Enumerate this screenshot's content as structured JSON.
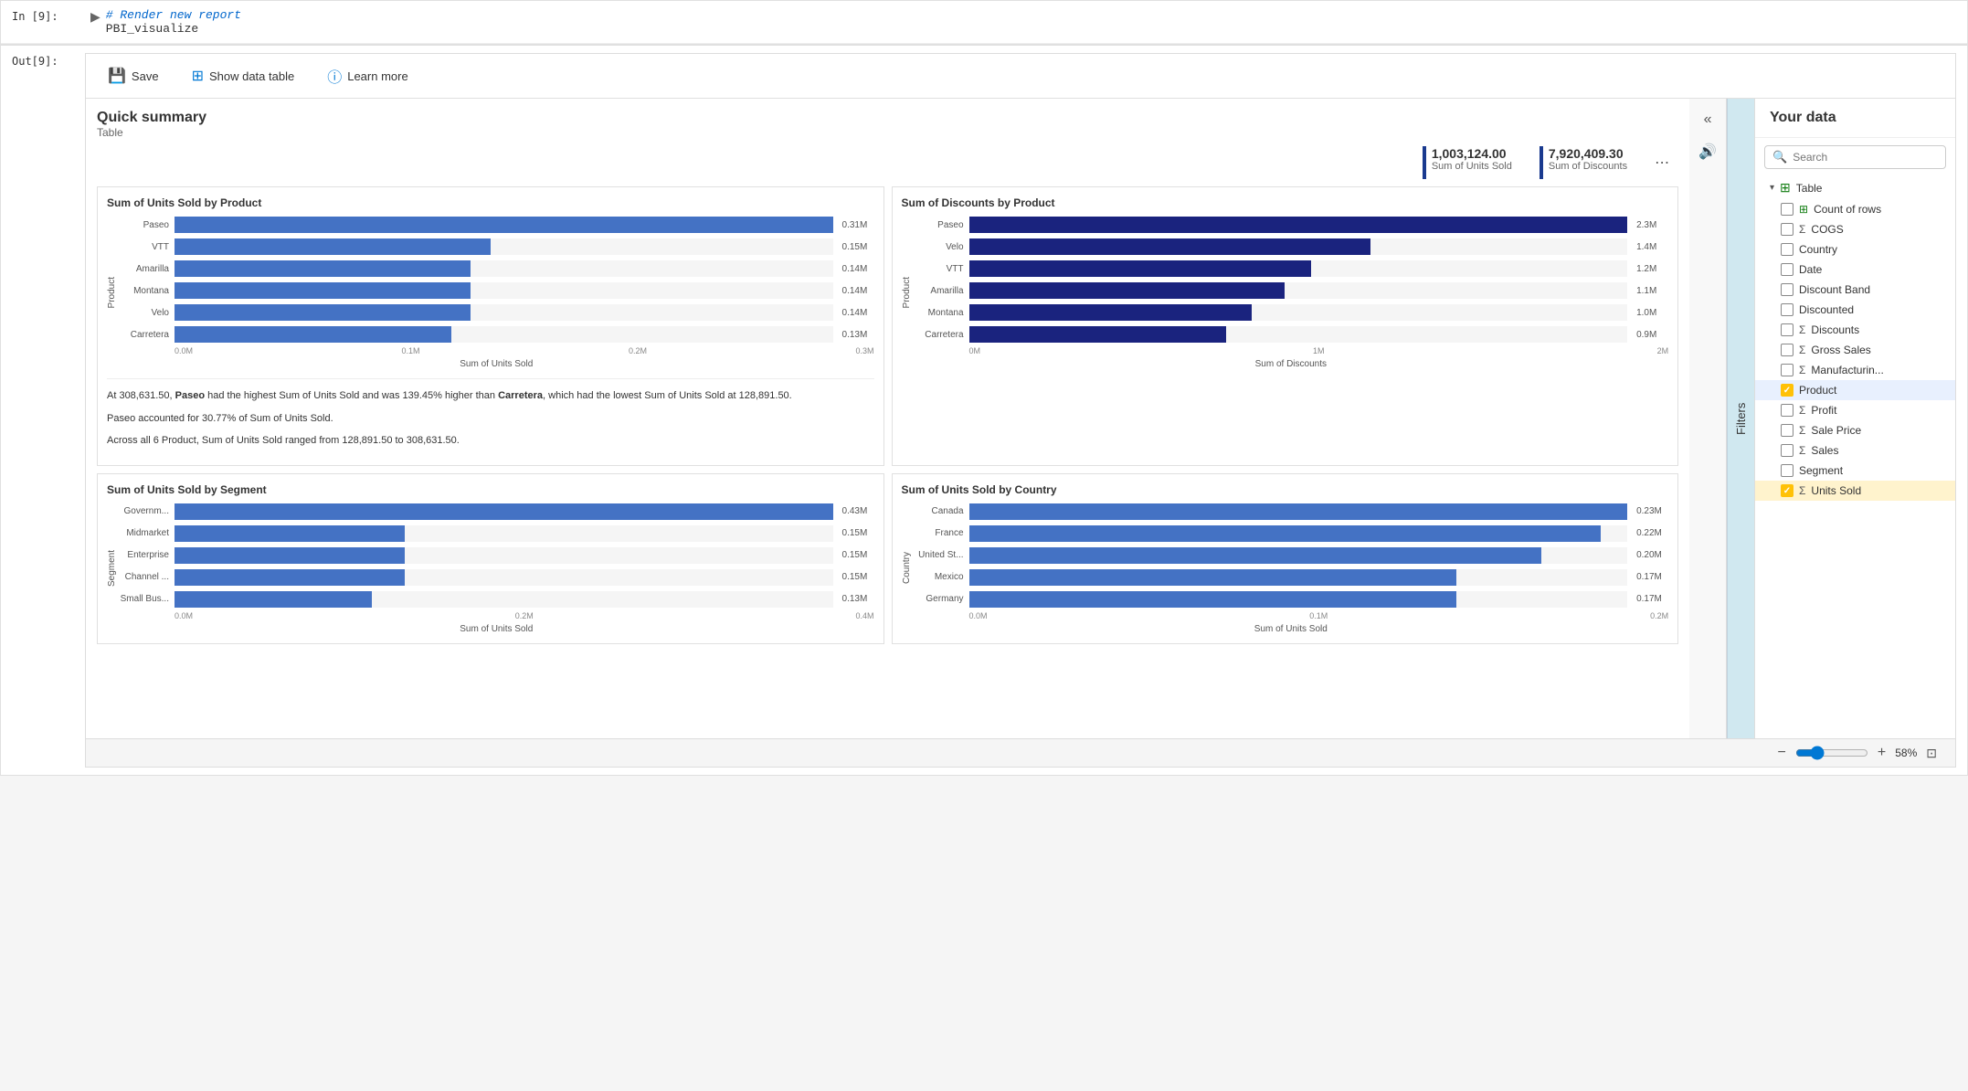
{
  "cell_input": {
    "label": "In [9]:",
    "code_comment": "# Render new report",
    "code_func": "PBI_visualize"
  },
  "cell_output": {
    "label": "Out[9]:"
  },
  "toolbar": {
    "save_label": "Save",
    "show_data_table_label": "Show data table",
    "learn_more_label": "Learn more"
  },
  "quick_summary": {
    "title": "Quick summary",
    "subtitle": "Table"
  },
  "stats": [
    {
      "value": "1,003,124.00",
      "label": "Sum of Units Sold"
    },
    {
      "value": "7,920,409.30",
      "label": "Sum of Discounts"
    }
  ],
  "chart1": {
    "title": "Sum of Units Sold by Product",
    "y_axis_label": "Product",
    "x_axis_label": "Sum of Units Sold",
    "x_ticks": [
      "0.0M",
      "0.1M",
      "0.2M",
      "0.3M"
    ],
    "bars": [
      {
        "label": "Paseo",
        "value": "0.31M",
        "pct": 100
      },
      {
        "label": "VTT",
        "value": "0.15M",
        "pct": 48
      },
      {
        "label": "Amarilla",
        "value": "0.14M",
        "pct": 45
      },
      {
        "label": "Montana",
        "value": "0.14M",
        "pct": 45
      },
      {
        "label": "Velo",
        "value": "0.14M",
        "pct": 45
      },
      {
        "label": "Carretera",
        "value": "0.13M",
        "pct": 42
      }
    ]
  },
  "chart2": {
    "title": "Sum of Discounts by Product",
    "y_axis_label": "Product",
    "x_axis_label": "Sum of Discounts",
    "x_ticks": [
      "0M",
      "1M",
      "2M"
    ],
    "bars": [
      {
        "label": "Paseo",
        "value": "2.3M",
        "pct": 100
      },
      {
        "label": "Velo",
        "value": "1.4M",
        "pct": 61
      },
      {
        "label": "VTT",
        "value": "1.2M",
        "pct": 52
      },
      {
        "label": "Amarilla",
        "value": "1.1M",
        "pct": 48
      },
      {
        "label": "Montana",
        "value": "1.0M",
        "pct": 43
      },
      {
        "label": "Carretera",
        "value": "0.9M",
        "pct": 39
      }
    ]
  },
  "chart3": {
    "title": "Sum of Units Sold by Segment",
    "y_axis_label": "Segment",
    "x_axis_label": "Sum of Units Sold",
    "x_ticks": [
      "0.0M",
      "0.2M",
      "0.4M"
    ],
    "bars": [
      {
        "label": "Governm...",
        "value": "0.43M",
        "pct": 100
      },
      {
        "label": "Midmarket",
        "value": "0.15M",
        "pct": 35
      },
      {
        "label": "Enterprise",
        "value": "0.15M",
        "pct": 35
      },
      {
        "label": "Channel ...",
        "value": "0.15M",
        "pct": 35
      },
      {
        "label": "Small Bus...",
        "value": "0.13M",
        "pct": 30
      }
    ]
  },
  "chart4": {
    "title": "Sum of Units Sold by Country",
    "y_axis_label": "Country",
    "x_axis_label": "Sum of Units Sold",
    "x_ticks": [
      "0.0M",
      "0.1M",
      "0.2M"
    ],
    "bars": [
      {
        "label": "Canada",
        "value": "0.23M",
        "pct": 100
      },
      {
        "label": "France",
        "value": "0.22M",
        "pct": 96
      },
      {
        "label": "United St...",
        "value": "0.20M",
        "pct": 87
      },
      {
        "label": "Mexico",
        "value": "0.17M",
        "pct": 74
      },
      {
        "label": "Germany",
        "value": "0.17M",
        "pct": 74
      }
    ]
  },
  "insight": {
    "text1": "At 308,631.50, Paseo had the highest Sum of Units Sold and was 139.45% higher than  Carretera, which had the lowest Sum of Units Sold at 128,891.50.",
    "text2": "Paseo accounted for 30.77% of Sum of Units Sold.",
    "text3": "Across all 6 Product, Sum of Units Sold ranged from 128,891.50 to 308,631.50."
  },
  "your_data": {
    "title": "Your data",
    "search_placeholder": "Search",
    "table_label": "Table",
    "fields": [
      {
        "name": "Count of rows",
        "type": "table",
        "checked": false
      },
      {
        "name": "COGS",
        "type": "sigma",
        "checked": false
      },
      {
        "name": "Country",
        "type": "field",
        "checked": false
      },
      {
        "name": "Date",
        "type": "field",
        "checked": false
      },
      {
        "name": "Discount Band",
        "type": "field",
        "checked": false
      },
      {
        "name": "Discounted",
        "type": "field",
        "checked": false
      },
      {
        "name": "Discounts",
        "type": "sigma",
        "checked": false
      },
      {
        "name": "Gross Sales",
        "type": "sigma",
        "checked": false
      },
      {
        "name": "Manufacturin...",
        "type": "sigma",
        "checked": false
      },
      {
        "name": "Product",
        "type": "field",
        "checked": true,
        "selected": true
      },
      {
        "name": "Profit",
        "type": "sigma",
        "checked": false
      },
      {
        "name": "Sale Price",
        "type": "sigma",
        "checked": false
      },
      {
        "name": "Sales",
        "type": "sigma",
        "checked": false
      },
      {
        "name": "Segment",
        "type": "field",
        "checked": false
      },
      {
        "name": "Units Sold",
        "type": "sigma",
        "checked": true,
        "highlighted": true
      }
    ]
  },
  "bottom_bar": {
    "zoom": "58%"
  },
  "filters_label": "Filters"
}
